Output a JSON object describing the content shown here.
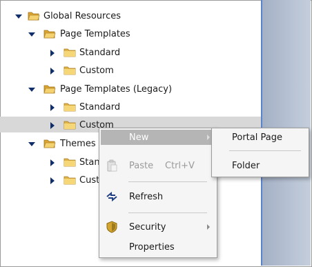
{
  "tree": {
    "nodes": [
      {
        "label": "Global Resources"
      },
      {
        "label": "Page Templates"
      },
      {
        "label": "Standard"
      },
      {
        "label": "Custom"
      },
      {
        "label": "Page Templates (Legacy)"
      },
      {
        "label": "Standard"
      },
      {
        "label": "Custom"
      },
      {
        "label": "Themes"
      },
      {
        "label": "Standard"
      },
      {
        "label": "Custom"
      }
    ]
  },
  "context_menu": {
    "items": [
      {
        "label": "New"
      },
      {
        "label": "Paste",
        "shortcut": "Ctrl+V"
      },
      {
        "label": "Refresh"
      },
      {
        "label": "Security"
      },
      {
        "label": "Properties"
      }
    ]
  },
  "submenu": {
    "items": [
      {
        "label": "Portal Page"
      },
      {
        "label": "Folder"
      }
    ]
  }
}
